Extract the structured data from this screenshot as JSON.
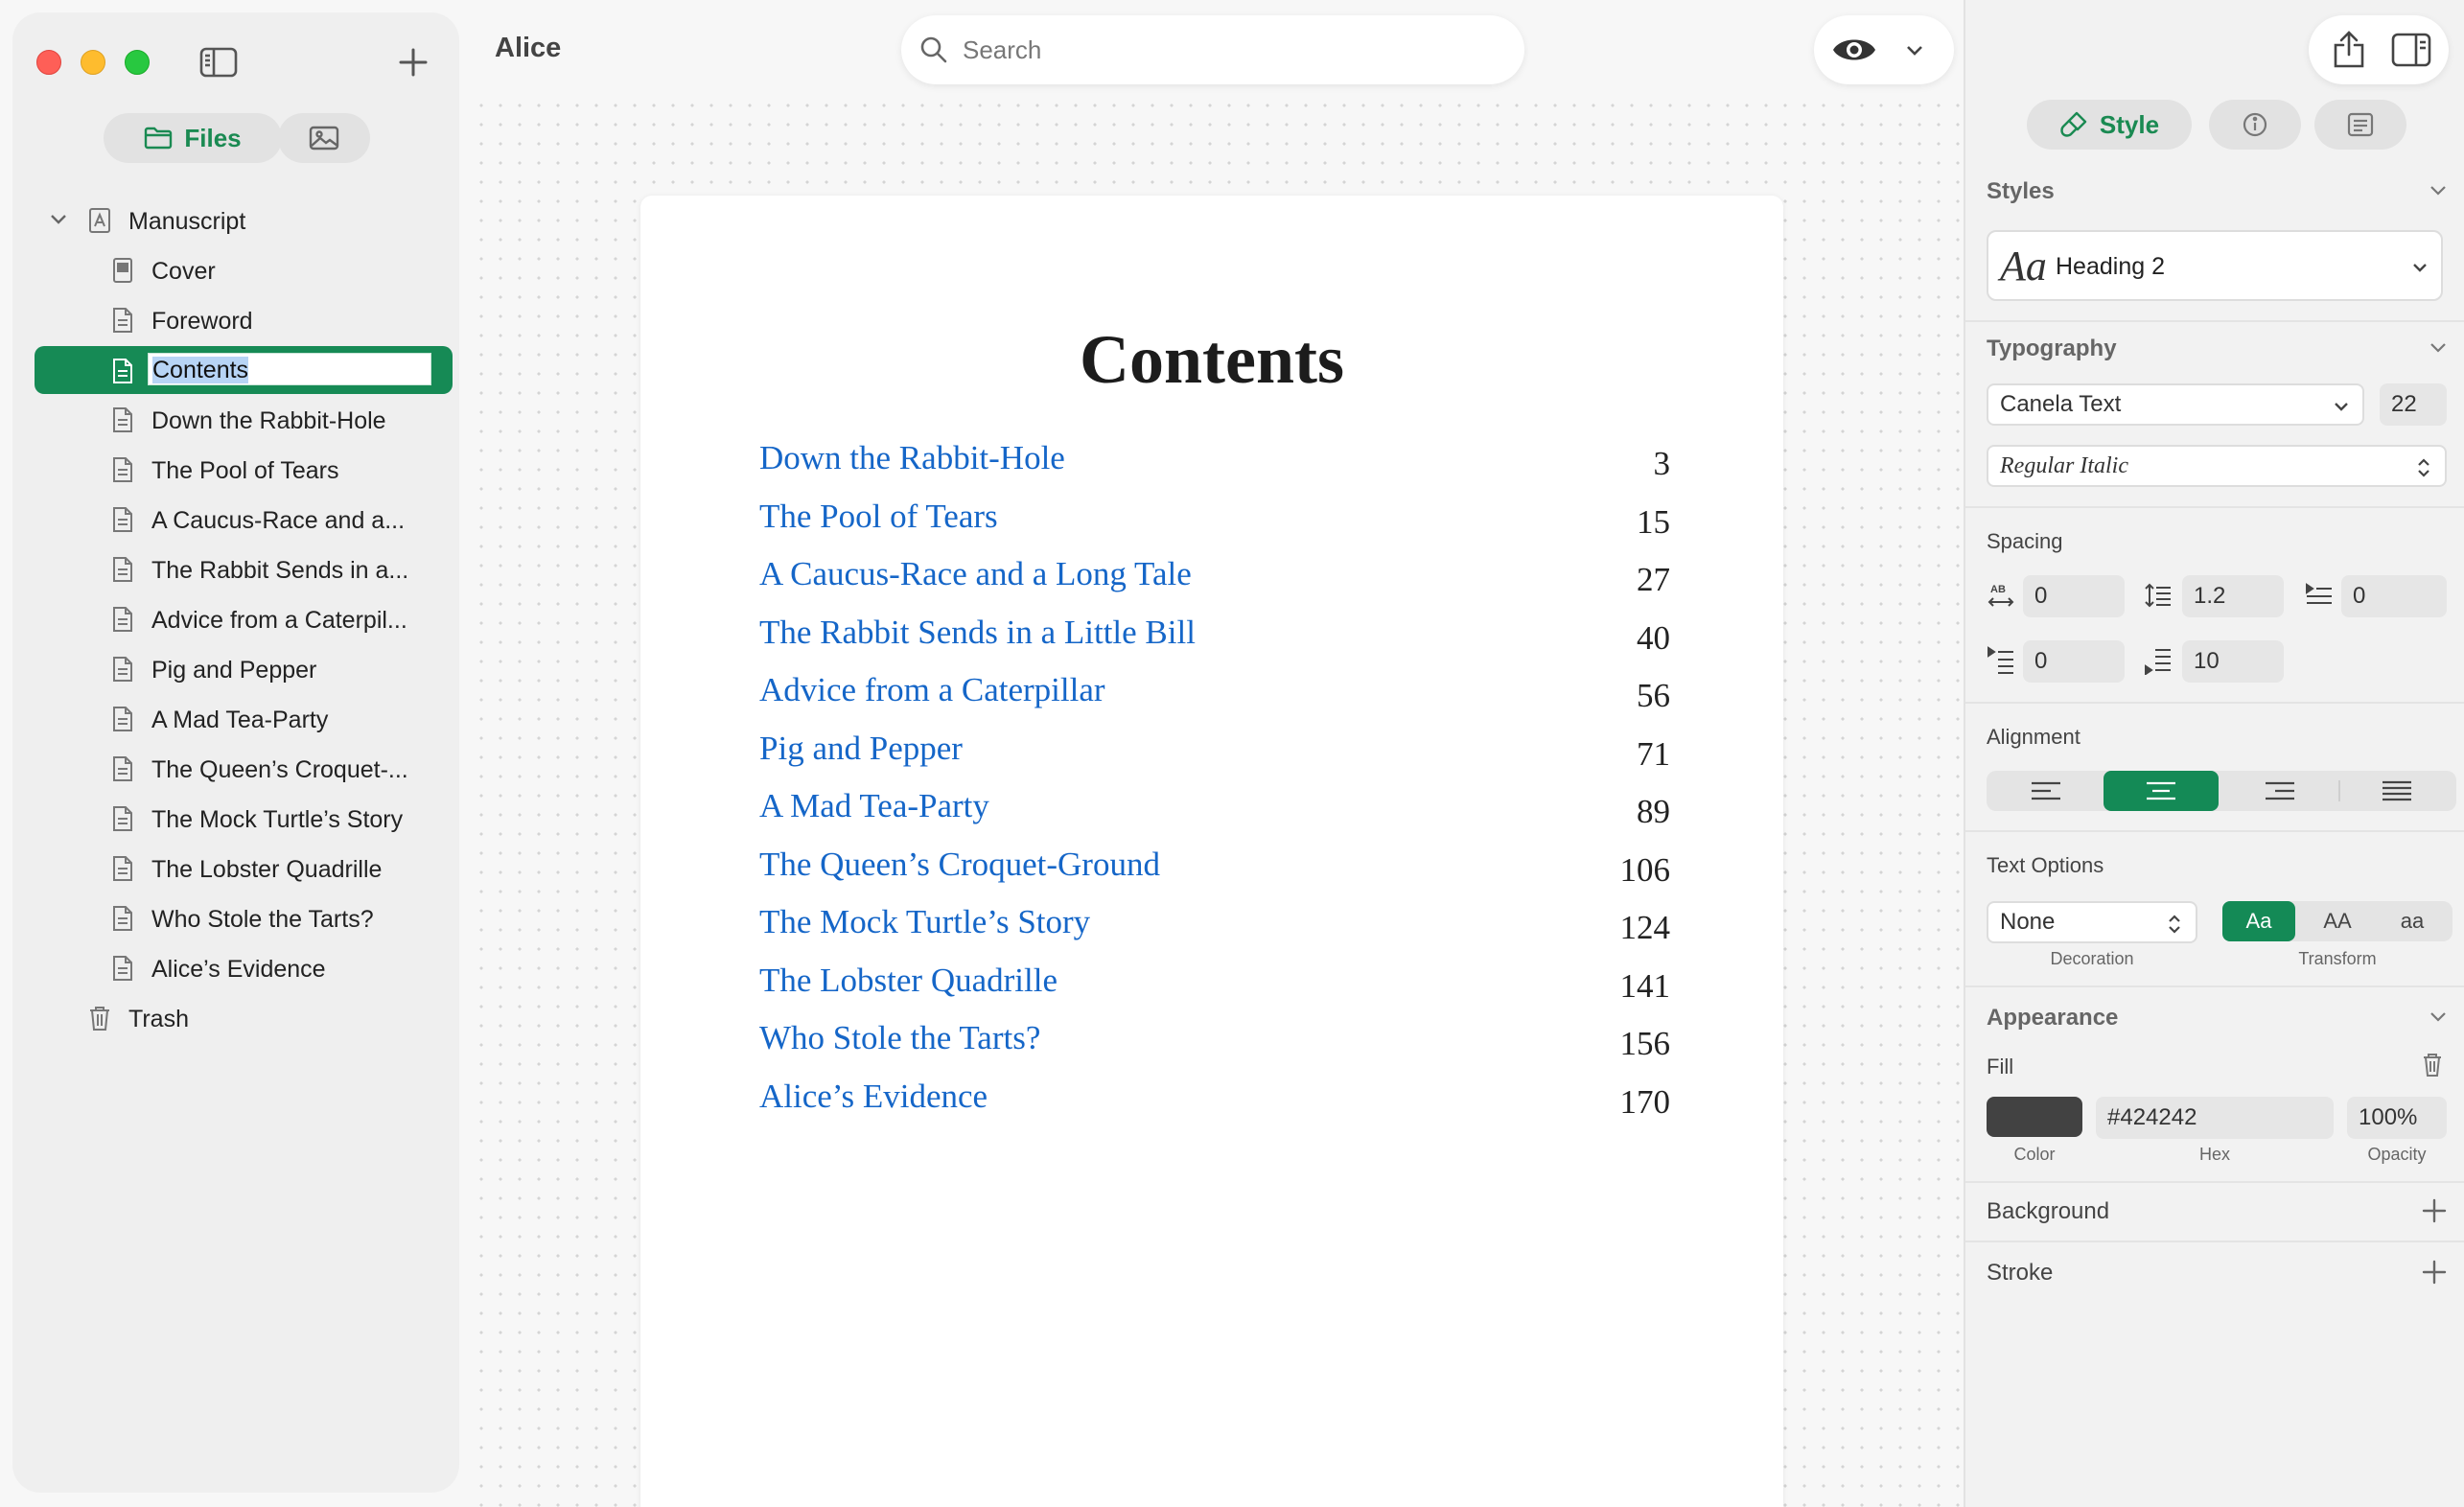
{
  "window": {
    "title": "Alice"
  },
  "sidebar": {
    "tabs": {
      "files": "Files"
    },
    "tree": {
      "root": "Manuscript",
      "items": [
        "Cover",
        "Foreword",
        "Contents",
        "Down the Rabbit-Hole",
        "The Pool of Tears",
        "A Caucus-Race and a...",
        "The Rabbit Sends in a...",
        "Advice from a Caterpil...",
        "Pig and Pepper",
        "A Mad Tea-Party",
        "The Queen’s Croquet-...",
        "The Mock Turtle’s Story",
        "The Lobster Quadrille",
        "Who Stole the Tarts?",
        "Alice’s Evidence"
      ],
      "selected": "Contents",
      "trash": "Trash"
    }
  },
  "toolbar": {
    "search_placeholder": "Search"
  },
  "document": {
    "heading": "Contents",
    "toc": [
      {
        "title": "Down the Rabbit-Hole",
        "page": "3"
      },
      {
        "title": "The Pool of Tears",
        "page": "15"
      },
      {
        "title": "A Caucus-Race and a Long Tale",
        "page": "27"
      },
      {
        "title": "The Rabbit Sends in a Little Bill",
        "page": "40"
      },
      {
        "title": "Advice from a Caterpillar",
        "page": "56"
      },
      {
        "title": "Pig and Pepper",
        "page": "71"
      },
      {
        "title": "A Mad Tea-Party",
        "page": "89"
      },
      {
        "title": "The Queen’s Croquet-Ground",
        "page": "106"
      },
      {
        "title": "The Mock Turtle’s Story",
        "page": "124"
      },
      {
        "title": "The Lobster Quadrille",
        "page": "141"
      },
      {
        "title": "Who Stole the Tarts?",
        "page": "156"
      },
      {
        "title": "Alice’s Evidence",
        "page": "170"
      }
    ]
  },
  "inspector": {
    "tabs": {
      "style": "Style"
    },
    "styles": {
      "header": "Styles",
      "glyph": "Aa",
      "selected": "Heading 2"
    },
    "typography": {
      "header": "Typography",
      "font": "Canela Text",
      "size": "22",
      "weight": "Regular Italic"
    },
    "spacing": {
      "label": "Spacing",
      "letter": "0",
      "line_height": "1.2",
      "indent": "0",
      "space_before": "0",
      "space_after": "10"
    },
    "alignment": {
      "label": "Alignment",
      "active": "center"
    },
    "text_options": {
      "label": "Text Options",
      "decoration": "None",
      "decoration_caption": "Decoration",
      "transform_caption": "Transform",
      "transform_options": [
        "Aa",
        "AA",
        "aa"
      ],
      "transform_active": "Aa"
    },
    "appearance": {
      "header": "Appearance",
      "fill_label": "Fill",
      "hex": "#424242",
      "opacity": "100%",
      "color_caption": "Color",
      "hex_caption": "Hex",
      "opacity_caption": "Opacity",
      "background": "Background",
      "stroke": "Stroke"
    }
  },
  "colors": {
    "accent": "#168a55",
    "link": "#1566c8",
    "fill": "#424242"
  }
}
